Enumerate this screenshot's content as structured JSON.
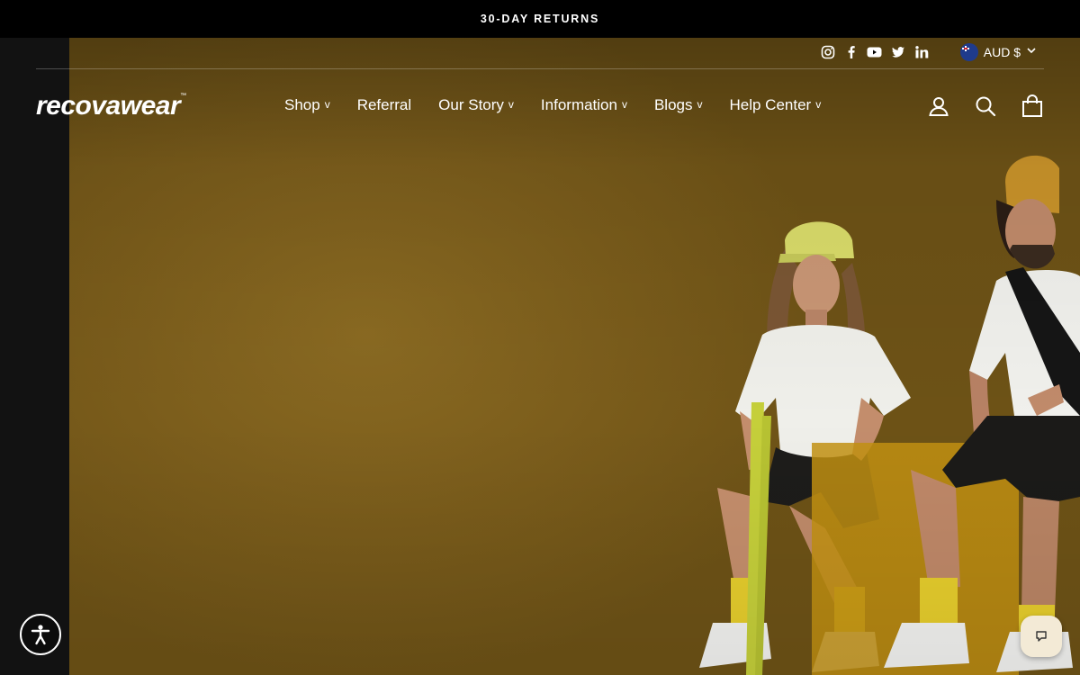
{
  "announcement": {
    "text": "30-DAY RETURNS"
  },
  "utility": {
    "social": [
      {
        "icon": "instagram-icon"
      },
      {
        "icon": "facebook-icon"
      },
      {
        "icon": "youtube-icon"
      },
      {
        "icon": "twitter-icon"
      },
      {
        "icon": "linkedin-icon"
      }
    ],
    "currency": {
      "label": "AUD $",
      "flag": "australia-flag-icon"
    }
  },
  "header": {
    "logo": "recovawear",
    "logo_mark": "™",
    "nav": [
      {
        "label": "Shop",
        "dropdown": "v"
      },
      {
        "label": "Referral"
      },
      {
        "label": "Our Story",
        "dropdown": "v"
      },
      {
        "label": "Information",
        "dropdown": "v"
      },
      {
        "label": "Blogs",
        "dropdown": "v"
      },
      {
        "label": "Help Center",
        "dropdown": "v"
      }
    ],
    "actions": [
      {
        "icon": "account-icon"
      },
      {
        "icon": "search-icon"
      },
      {
        "icon": "cart-icon"
      }
    ]
  },
  "colors": {
    "hero_bg": "#7a5c1b",
    "announce_bg": "#000000",
    "left_strip": "#121212",
    "chat_bg": "#f3ead6"
  }
}
